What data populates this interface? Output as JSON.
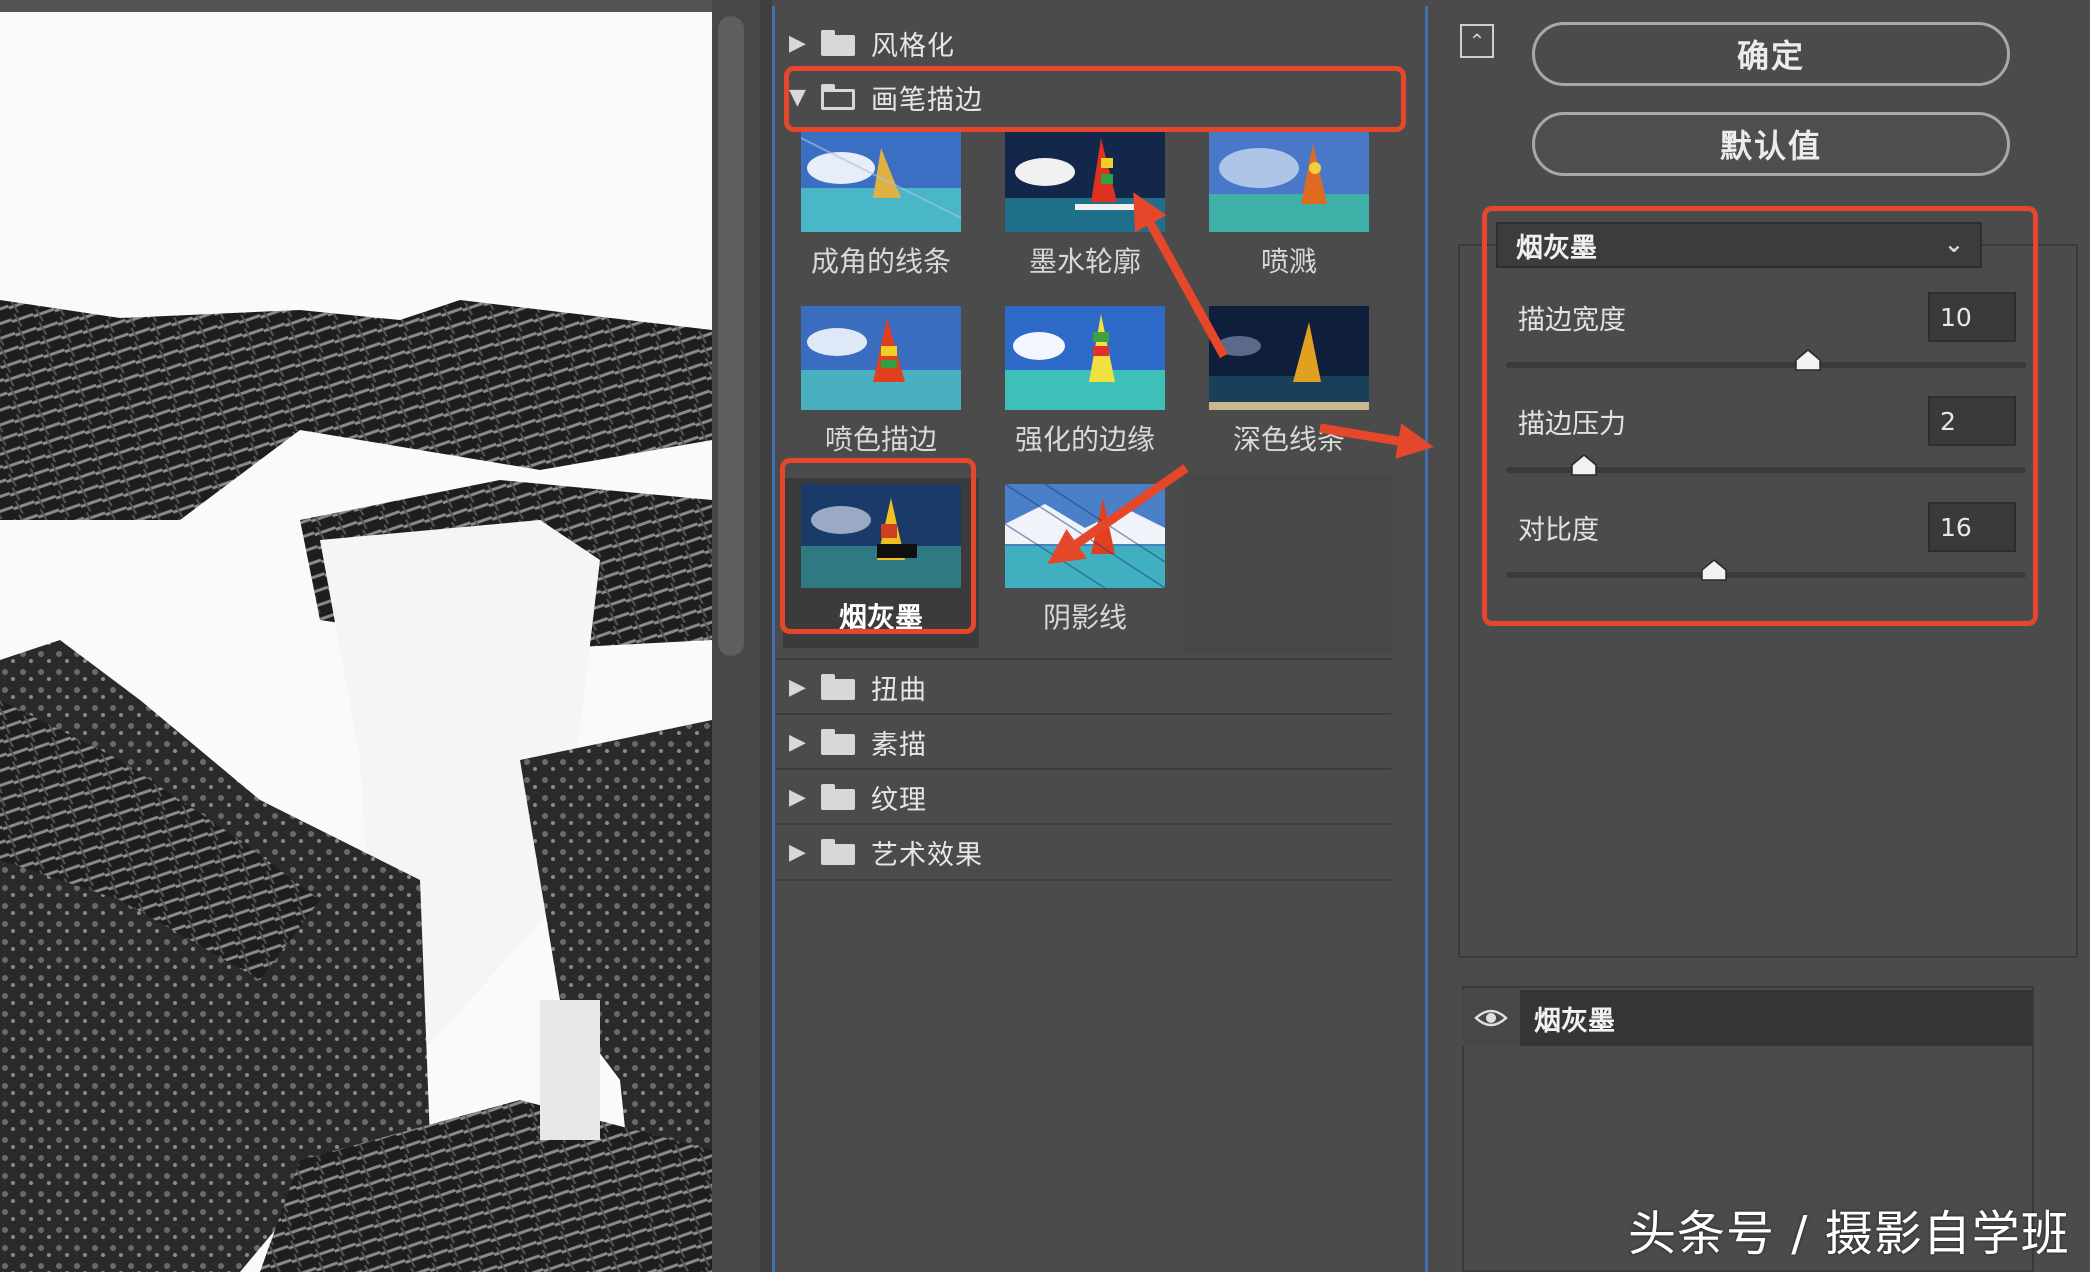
{
  "gallery": {
    "folders_top": [
      {
        "label": "风格化",
        "expanded": false
      },
      {
        "label": "画笔描边",
        "expanded": true
      }
    ],
    "thumbnails": [
      {
        "label": "成角的线条"
      },
      {
        "label": "墨水轮廓"
      },
      {
        "label": "喷溅"
      },
      {
        "label": "喷色描边"
      },
      {
        "label": "强化的边缘"
      },
      {
        "label": "深色线条"
      },
      {
        "label": "烟灰墨",
        "selected": true
      },
      {
        "label": "阴影线"
      }
    ],
    "folders_bottom": [
      {
        "label": "扭曲"
      },
      {
        "label": "素描"
      },
      {
        "label": "纹理"
      },
      {
        "label": "艺术效果"
      }
    ]
  },
  "actions": {
    "ok_label": "确定",
    "default_label": "默认值",
    "collapse_icon": "collapse-up-icon"
  },
  "settings": {
    "filter_name": "烟灰墨",
    "params": [
      {
        "label": "描边宽度",
        "value": "10",
        "fraction": 0.58
      },
      {
        "label": "描边压力",
        "value": "2",
        "fraction": 0.15
      },
      {
        "label": "对比度",
        "value": "16",
        "fraction": 0.4
      }
    ]
  },
  "layers": {
    "items": [
      {
        "label": "烟灰墨",
        "visible": true
      }
    ]
  },
  "watermark": "头条号 / 摄影自学班",
  "colors": {
    "accent_annotation": "#e4472a",
    "panel_bg": "#4b4b4b",
    "focus_border": "#3f6fb5"
  }
}
